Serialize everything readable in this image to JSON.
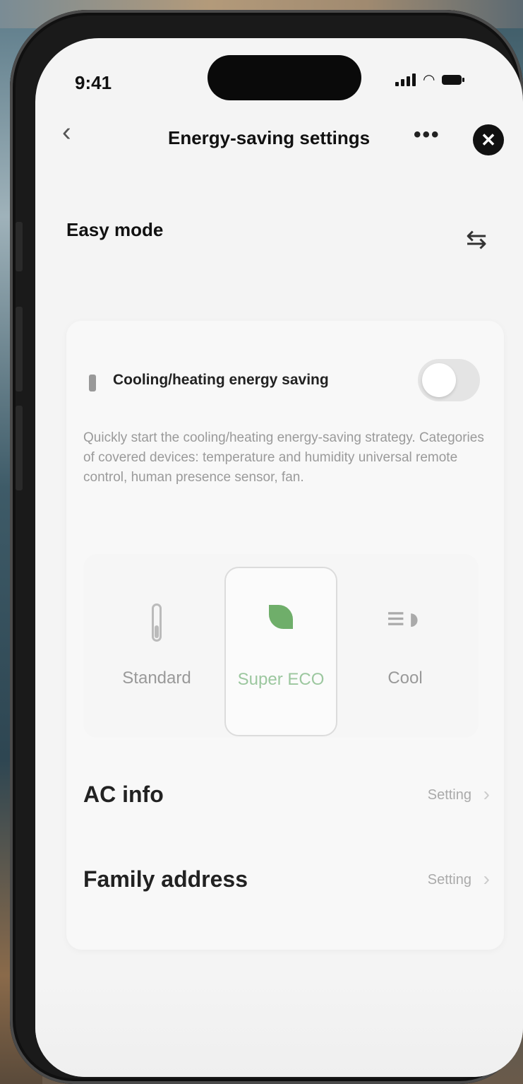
{
  "status_bar": {
    "time": "9:41"
  },
  "nav": {
    "back_icon": "chevron-left-icon",
    "title": "Energy-saving settings",
    "more_icon": "more-horizontal-icon",
    "close_icon": "close-icon"
  },
  "section": {
    "title": "Easy mode",
    "switch_icon": "swap-icon"
  },
  "cooling_heating": {
    "title": "Cooling/heating energy saving",
    "toggle_on": false,
    "description": "Quickly start the cooling/heating energy-saving strategy. Categories of covered devices: temperature and humidity universal remote control, human presence sensor, fan."
  },
  "modes": {
    "options": [
      {
        "label": "Standard",
        "icon": "thermometer-icon"
      },
      {
        "label": "Super ECO",
        "icon": "leaf-icon"
      },
      {
        "label": "Cool",
        "icon": "fan-icon"
      }
    ],
    "selected": "Super ECO",
    "accent_color": "#6fae6a"
  },
  "settings_rows": [
    {
      "label": "AC info",
      "value": "Setting"
    },
    {
      "label": "Family address",
      "value": "Setting"
    }
  ]
}
